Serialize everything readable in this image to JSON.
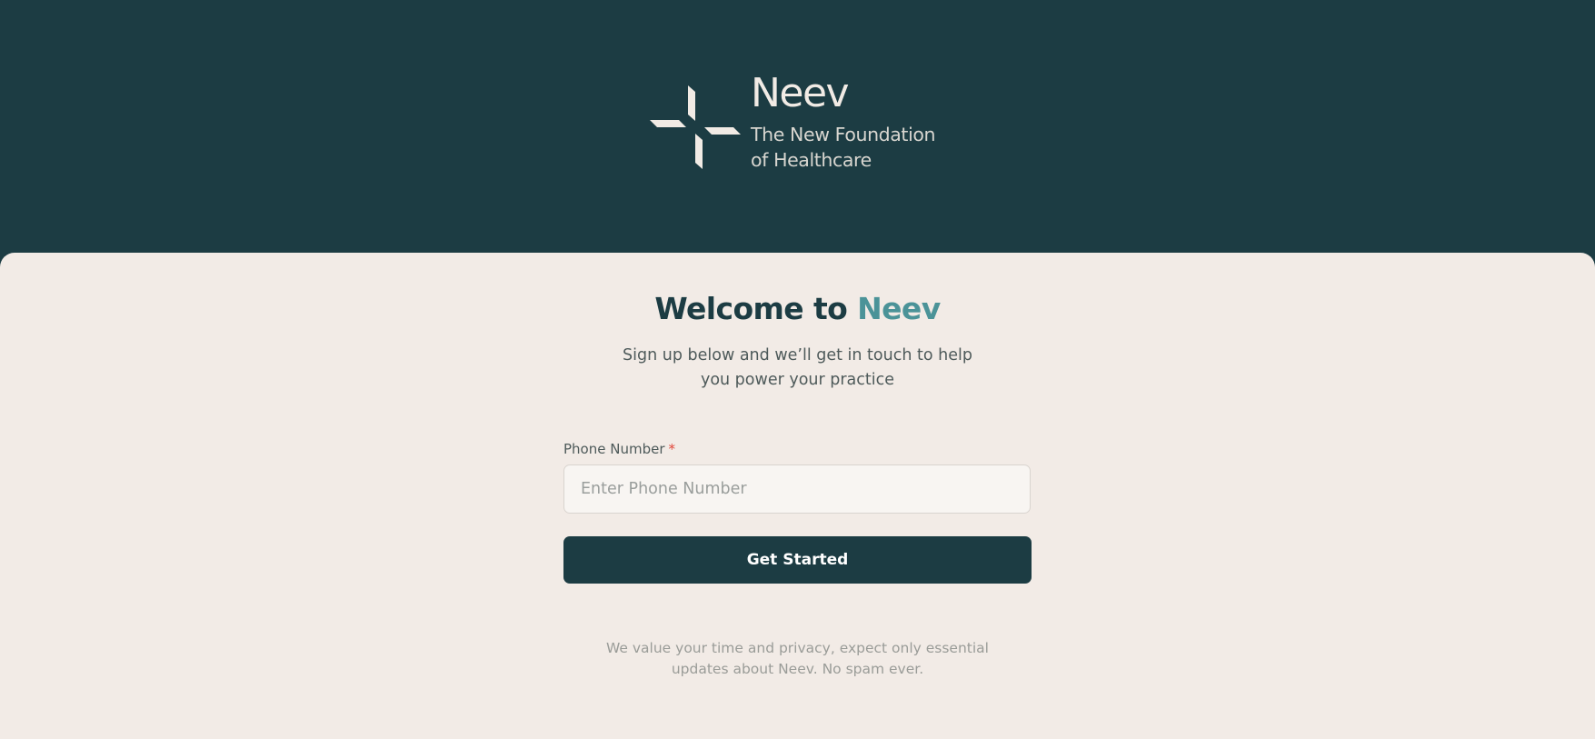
{
  "brand": {
    "name": "Neev",
    "tagline_line1": "The New Foundation",
    "tagline_line2": "of Healthcare",
    "logo_icon": "cross-pinwheel-icon"
  },
  "hero": {
    "title_prefix": "Welcome to",
    "title_accent": "Neev",
    "subtitle_line1": "Sign up below and we’ll get in touch to help",
    "subtitle_line2": "you power your practice"
  },
  "form": {
    "phone_label": "Phone Number",
    "required_marker": "*",
    "phone_value": "",
    "phone_placeholder": "Enter Phone Number",
    "submit_label": "Get Started"
  },
  "footer": {
    "note_line1": "We value your time and privacy, expect only essential",
    "note_line2": "updates about Neev. No spam ever."
  },
  "colors": {
    "header_bg": "#1c3c43",
    "card_bg": "#f2ebe6",
    "accent": "#4b9398",
    "button_bg": "#1c3c43",
    "required": "#e1463a"
  }
}
